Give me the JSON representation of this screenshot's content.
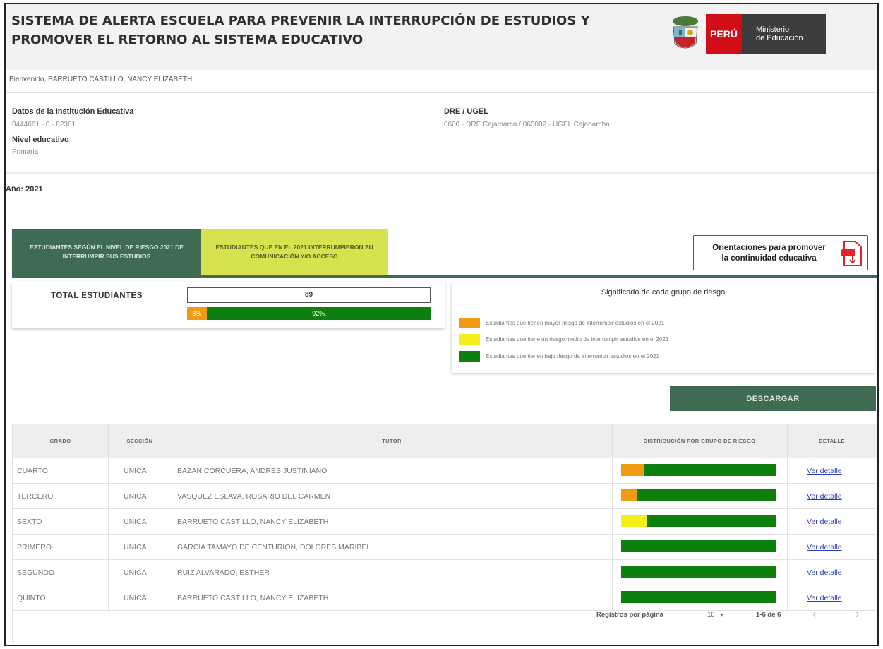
{
  "header": {
    "title_line1": "SISTEMA DE ALERTA ESCUELA PARA PREVENIR LA INTERRUPCIÓN DE ESTUDIOS Y",
    "title_line2": "PROMOVER EL RETORNO AL SISTEMA EDUCATIVO",
    "logo_country": "PERÚ",
    "logo_ministry_line1": "Ministerio",
    "logo_ministry_line2": "de Educación",
    "brand_red": "#d10e17"
  },
  "welcome": "Bienvenido, BARRUETO CASTILLO, NANCY ELIZABETH",
  "institution": {
    "label": "Datos de la Institución Educativa",
    "value": "0444661 - 0 - 82381",
    "level_label": "Nivel educativo",
    "level_value": "Primaria",
    "dre_label": "DRE / UGEL",
    "dre_value": "0600 - DRE Cajamarca / 060002 - UGEL Cajabamba"
  },
  "year_label": "Año: 2021",
  "tabs": [
    {
      "label": "ESTUDIANTES SEGÚN EL NIVEL DE RIESGO 2021 DE INTERRUMPIR SUS ESTUDIOS",
      "active": true
    },
    {
      "label": "ESTUDIANTES QUE EN EL 2021 INTERRUMPIERON SU COMUNICACIÓN y/o ACCESO",
      "active": false
    }
  ],
  "orient_button": {
    "line1": "Orientaciones para promover",
    "line2": "la continuidad educativa",
    "icon": "pdf-document-icon"
  },
  "summary": {
    "total_label": "TOTAL ESTUDIANTES",
    "total_value": "89",
    "distribution": [
      {
        "group": "alto",
        "percent": 8,
        "label": "8%",
        "color": "#f29a12"
      },
      {
        "group": "medio",
        "percent": 0,
        "label": "",
        "color": "#f4ef1a"
      },
      {
        "group": "bajo",
        "percent": 92,
        "label": "92%",
        "color": "#0e800e"
      }
    ]
  },
  "legend": {
    "title": "Significado de cada grupo de riesgo",
    "items": [
      {
        "text": "Estudiantes que tienen mayor riesgo de interrumpir estudios en el 2021",
        "color": "#f29a12"
      },
      {
        "text": "Estudiantes que tiene un riesgo medio de interrumpir estudios en el 2021",
        "color": "#f4ef1a"
      },
      {
        "text": "Estudiantes que tienen bajo riesgo de interrumpir estudios en el 2021",
        "color": "#0e800e"
      }
    ]
  },
  "download_label": "DESCARGAR",
  "table": {
    "headers": [
      "GRADO",
      "SECCIÓN",
      "TUTOR",
      "DISTRIBUCIÓN POR GRUPO DE RIESGO",
      "DETALLE"
    ],
    "rows": [
      {
        "grado": "CUARTO",
        "seccion": "UNICA",
        "tutor": "BAZAN CORCUERA, ANDRES JUSTINIANO",
        "dist": [
          15,
          0,
          85
        ],
        "detalle": "Ver detalle"
      },
      {
        "grado": "TERCERO",
        "seccion": "UNICA",
        "tutor": "VASQUEZ ESLAVA, ROSARIO DEL CARMEN",
        "dist": [
          10,
          0,
          90
        ],
        "detalle": "Ver detalle"
      },
      {
        "grado": "SEXTO",
        "seccion": "UNICA",
        "tutor": "BARRUETO CASTILLO, NANCY ELIZABETH",
        "dist": [
          0,
          17,
          83
        ],
        "detalle": "Ver detalle"
      },
      {
        "grado": "PRIMERO",
        "seccion": "UNICA",
        "tutor": "GARCIA TAMAYO DE CENTURION, DOLORES MARIBEL",
        "dist": [
          0,
          0,
          100
        ],
        "detalle": "Ver detalle"
      },
      {
        "grado": "SEGUNDO",
        "seccion": "UNICA",
        "tutor": "RUIZ ALVARADO, ESTHER",
        "dist": [
          0,
          0,
          100
        ],
        "detalle": "Ver detalle"
      },
      {
        "grado": "QUINTO",
        "seccion": "UNICA",
        "tutor": "BARRUETO CASTILLO, NANCY ELIZABETH",
        "dist": [
          0,
          0,
          100
        ],
        "detalle": "Ver detalle"
      }
    ]
  },
  "pagination": {
    "per_page_label": "Registros por página",
    "per_page_value": "10",
    "range": "1-6 de 6",
    "prev_icon": "chevron-left-icon",
    "next_icon": "chevron-right-icon"
  }
}
